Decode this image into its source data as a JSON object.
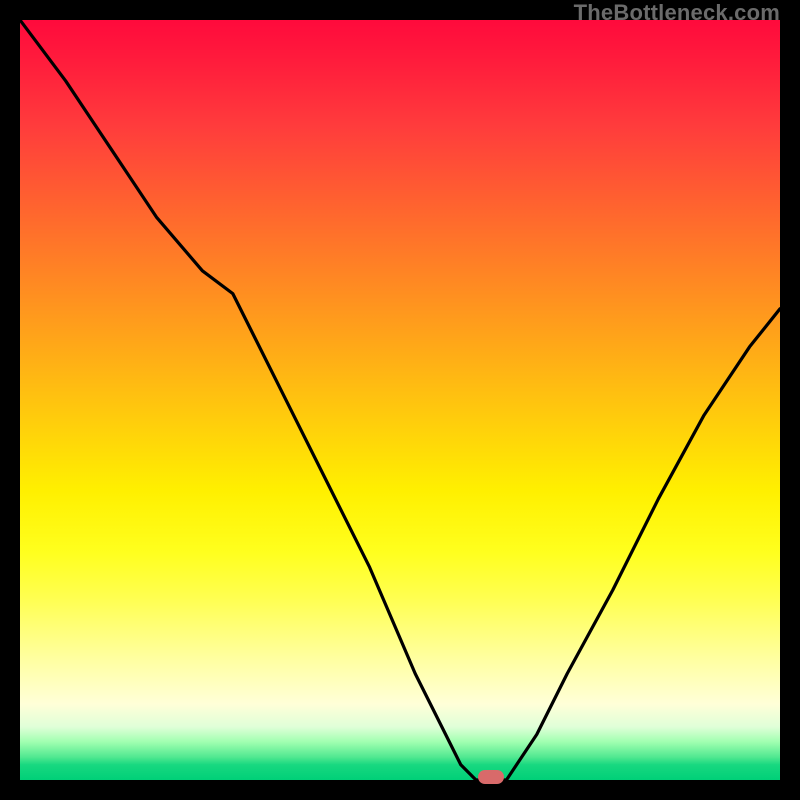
{
  "watermark": "TheBottleneck.com",
  "colors": {
    "background": "#000000",
    "curve": "#000000",
    "marker": "#d86a6a",
    "watermark": "#6b6b6b"
  },
  "chart_data": {
    "type": "line",
    "title": "",
    "xlabel": "",
    "ylabel": "",
    "xlim": [
      0,
      100
    ],
    "ylim": [
      0,
      100
    ],
    "series": [
      {
        "name": "bottleneck-curve",
        "x": [
          0,
          6,
          12,
          18,
          24,
          28,
          34,
          40,
          46,
          52,
          56,
          58,
          60,
          62,
          64,
          68,
          72,
          78,
          84,
          90,
          96,
          100
        ],
        "y": [
          100,
          92,
          83,
          74,
          67,
          64,
          52,
          40,
          28,
          14,
          6,
          2,
          0,
          0,
          0,
          6,
          14,
          25,
          37,
          48,
          57,
          62
        ]
      }
    ],
    "marker": {
      "x": 62,
      "y": 0
    },
    "annotations": []
  }
}
